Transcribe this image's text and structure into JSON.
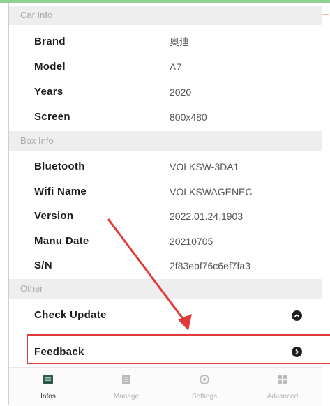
{
  "sections": [
    {
      "title": "Car Info",
      "rows": [
        {
          "label": "Brand",
          "value": "奥迪"
        },
        {
          "label": "Model",
          "value": "A7"
        },
        {
          "label": "Years",
          "value": "2020"
        },
        {
          "label": "Screen",
          "value": "800x480"
        }
      ]
    },
    {
      "title": "Box Info",
      "rows": [
        {
          "label": "Bluetooth",
          "value": "VOLKSW-3DA1"
        },
        {
          "label": "Wifi Name",
          "value": "VOLKSWAGENEC"
        },
        {
          "label": "Version",
          "value": "2022.01.24.1903"
        },
        {
          "label": "Manu Date",
          "value": "20210705"
        },
        {
          "label": "S/N",
          "value": "2f83ebf76c6ef7fa3"
        }
      ]
    },
    {
      "title": "Other",
      "rows": [
        {
          "label": "Check Update",
          "icon": "chevron-up-icon"
        },
        {
          "label": "Feedback",
          "icon": "chevron-right-icon"
        }
      ]
    }
  ],
  "tabs": [
    {
      "label": "Infos",
      "icon": "info-card-icon",
      "active": true
    },
    {
      "label": "Manage",
      "icon": "manage-icon",
      "active": false
    },
    {
      "label": "Settings",
      "icon": "settings-icon",
      "active": false
    },
    {
      "label": "Advanced",
      "icon": "grid-icon",
      "active": false
    }
  ],
  "colors": {
    "highlight": "#e23a3a",
    "header_bg": "#eeeeee",
    "header_text": "#a9a9a9"
  }
}
